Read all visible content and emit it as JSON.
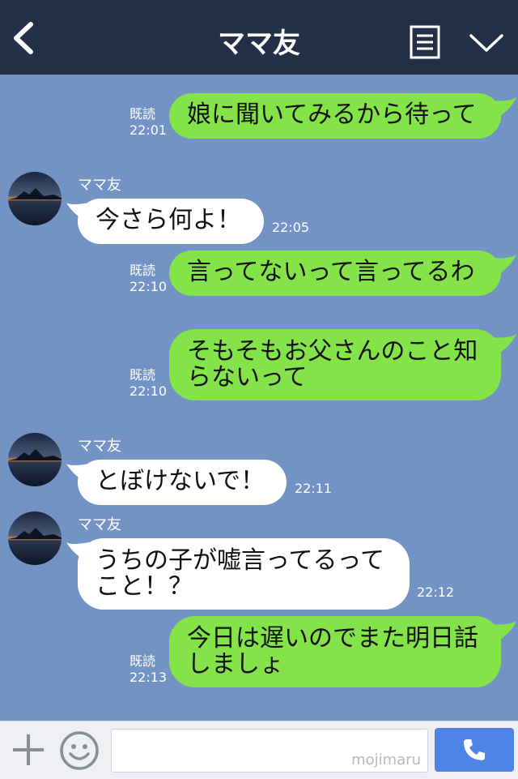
{
  "header": {
    "title": "ママ友"
  },
  "read_label": "既読",
  "messages": [
    {
      "text": "娘に聞いてみるから待って",
      "time": "22:01"
    },
    {
      "sender": "ママ友",
      "text": "今さら何よ！",
      "time": "22:05"
    },
    {
      "text": "言ってないって言ってるわ",
      "time": "22:10"
    },
    {
      "text": "そもそもお父さんのこと知らないって",
      "line1": "そもそもお父さんのこと知",
      "line2": "らないって",
      "time": "22:10"
    },
    {
      "sender": "ママ友",
      "text": "とぼけないで！",
      "time": "22:11"
    },
    {
      "sender": "ママ友",
      "text": "うちの子が嘘言ってるってこと！？",
      "line1": "うちの子が嘘言ってるって",
      "line2": "こと！？",
      "time": "22:12"
    },
    {
      "text": "今日は遅いのでまた明日話しましょ",
      "line1": "今日は遅いのでまた明日話",
      "line2": "しましょ",
      "time": "22:13"
    }
  ],
  "input": {
    "watermark": "mojimaru"
  },
  "icons": [
    "back-icon",
    "menu-icon",
    "chevron-down-icon",
    "plus-icon",
    "emoji-icon",
    "phone-icon"
  ],
  "colors": {
    "background": "#7393c5",
    "header": "#243048",
    "outgoing": "#83e348",
    "incoming": "#ffffff",
    "call": "#4d84e6"
  }
}
